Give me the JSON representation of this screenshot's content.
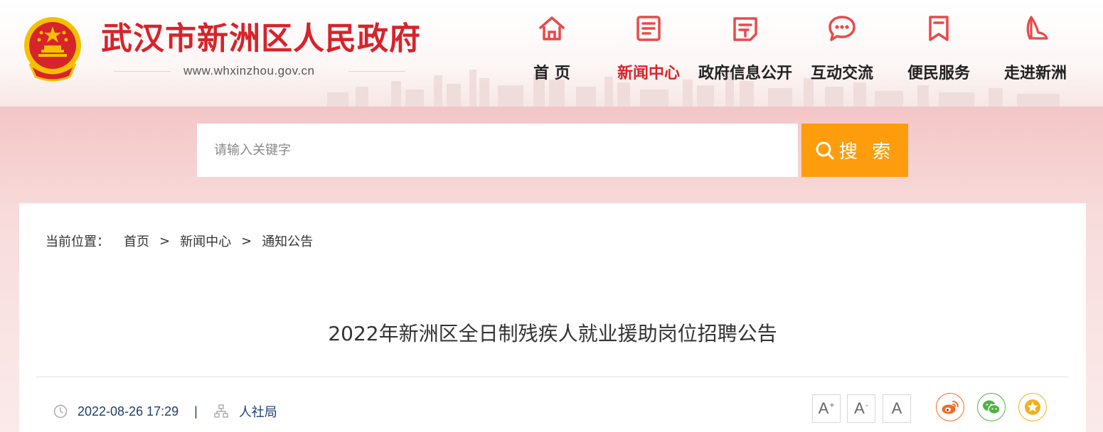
{
  "header": {
    "site_title": "武汉市新洲区人民政府",
    "site_url": "www.whxinzhou.gov.cn",
    "brand_color": "#d7232a"
  },
  "nav": {
    "items": [
      {
        "label": "首 页",
        "icon": "home-icon",
        "active": false
      },
      {
        "label": "新闻中心",
        "icon": "news-icon",
        "active": true
      },
      {
        "label": "政府信息公开",
        "icon": "gov-info-icon",
        "active": false
      },
      {
        "label": "互动交流",
        "icon": "chat-icon",
        "active": false
      },
      {
        "label": "便民服务",
        "icon": "bookmark-icon",
        "active": false
      },
      {
        "label": "走进新洲",
        "icon": "sail-icon",
        "active": false
      }
    ]
  },
  "search": {
    "placeholder": "请输入关键字",
    "button_label": "搜 索",
    "button_color": "#fd9d0d"
  },
  "breadcrumb": {
    "label": "当前位置：",
    "items": [
      "首页",
      "新闻中心",
      "通知公告"
    ],
    "separator": ">"
  },
  "article": {
    "title": "2022年新洲区全日制残疾人就业援助岗位招聘公告",
    "date": "2022-08-26 17:29",
    "meta_separator": "|",
    "department": "人社局"
  },
  "font_size_controls": {
    "large": "A",
    "small": "A",
    "default": "A",
    "large_mark": "+",
    "small_mark": "-"
  },
  "share": [
    {
      "icon": "weibo-icon",
      "color": "#f46b1f"
    },
    {
      "icon": "wechat-icon",
      "color": "#4fb33f"
    },
    {
      "icon": "favorite-star-icon",
      "color": "#f2b01e"
    }
  ]
}
